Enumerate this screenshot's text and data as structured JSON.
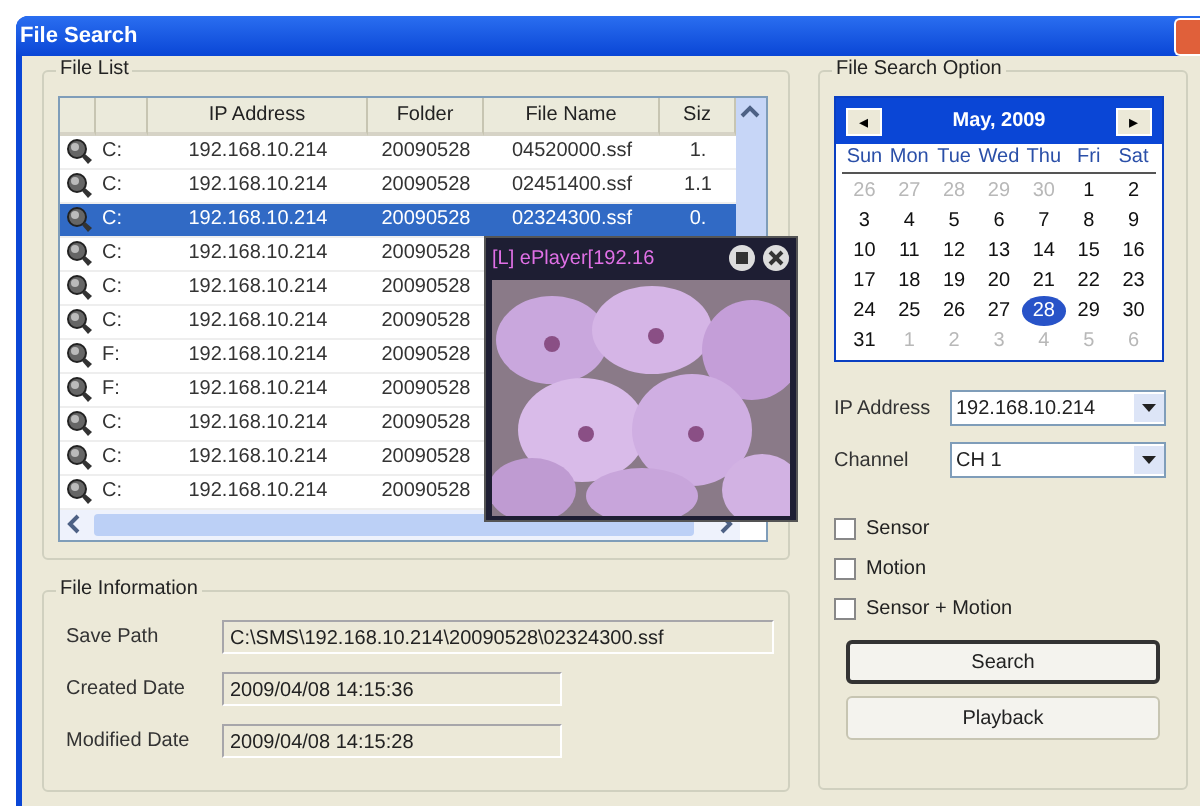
{
  "window": {
    "title": "File Search"
  },
  "file_list": {
    "title": "File List",
    "columns": [
      "IP Address",
      "Folder",
      "File Name",
      "Siz"
    ],
    "rows": [
      {
        "drive": "C:",
        "ip": "192.168.10.214",
        "folder": "20090528",
        "file": "04520000.ssf",
        "size": "1.",
        "selected": false
      },
      {
        "drive": "C:",
        "ip": "192.168.10.214",
        "folder": "20090528",
        "file": "02451400.ssf",
        "size": "1.1",
        "selected": false
      },
      {
        "drive": "C:",
        "ip": "192.168.10.214",
        "folder": "20090528",
        "file": "02324300.ssf",
        "size": "0.",
        "selected": true
      },
      {
        "drive": "C:",
        "ip": "192.168.10.214",
        "folder": "20090528",
        "selected": false
      },
      {
        "drive": "C:",
        "ip": "192.168.10.214",
        "folder": "20090528",
        "selected": false
      },
      {
        "drive": "C:",
        "ip": "192.168.10.214",
        "folder": "20090528",
        "selected": false
      },
      {
        "drive": "F:",
        "ip": "192.168.10.214",
        "folder": "20090528",
        "selected": false
      },
      {
        "drive": "F:",
        "ip": "192.168.10.214",
        "folder": "20090528",
        "selected": false
      },
      {
        "drive": "C:",
        "ip": "192.168.10.214",
        "folder": "20090528",
        "selected": false
      },
      {
        "drive": "C:",
        "ip": "192.168.10.214",
        "folder": "20090528",
        "selected": false
      },
      {
        "drive": "C:",
        "ip": "192.168.10.214",
        "folder": "20090528",
        "selected": false
      }
    ]
  },
  "player": {
    "title": "[L] ePlayer[192.16"
  },
  "file_information": {
    "title": "File Information",
    "fields": [
      {
        "label": "Save Path",
        "value": "C:\\SMS\\192.168.10.214\\20090528\\02324300.ssf",
        "kind": "wide"
      },
      {
        "label": "Created Date",
        "value": "2009/04/08 14:15:36",
        "kind": "short"
      },
      {
        "label": "Modified Date",
        "value": "2009/04/08 14:15:28",
        "kind": "short"
      }
    ]
  },
  "search_option": {
    "title": "File Search Option",
    "calendar": {
      "month": "May, 2009",
      "prev": "◂",
      "next": "▸",
      "weekdays": [
        "Sun",
        "Mon",
        "Tue",
        "Wed",
        "Thu",
        "Fri",
        "Sat"
      ],
      "days": [
        {
          "label": "26",
          "other_month": true,
          "selected": false
        },
        {
          "label": "27",
          "other_month": true,
          "selected": false
        },
        {
          "label": "28",
          "other_month": true,
          "selected": false
        },
        {
          "label": "29",
          "other_month": true,
          "selected": false
        },
        {
          "label": "30",
          "other_month": true,
          "selected": false
        },
        {
          "label": "1",
          "other_month": false,
          "selected": false
        },
        {
          "label": "2",
          "other_month": false,
          "selected": false
        },
        {
          "label": "3",
          "other_month": false,
          "selected": false
        },
        {
          "label": "4",
          "other_month": false,
          "selected": false
        },
        {
          "label": "5",
          "other_month": false,
          "selected": false
        },
        {
          "label": "6",
          "other_month": false,
          "selected": false
        },
        {
          "label": "7",
          "other_month": false,
          "selected": false
        },
        {
          "label": "8",
          "other_month": false,
          "selected": false
        },
        {
          "label": "9",
          "other_month": false,
          "selected": false
        },
        {
          "label": "10",
          "other_month": false,
          "selected": false
        },
        {
          "label": "11",
          "other_month": false,
          "selected": false
        },
        {
          "label": "12",
          "other_month": false,
          "selected": false
        },
        {
          "label": "13",
          "other_month": false,
          "selected": false
        },
        {
          "label": "14",
          "other_month": false,
          "selected": false
        },
        {
          "label": "15",
          "other_month": false,
          "selected": false
        },
        {
          "label": "16",
          "other_month": false,
          "selected": false
        },
        {
          "label": "17",
          "other_month": false,
          "selected": false
        },
        {
          "label": "18",
          "other_month": false,
          "selected": false
        },
        {
          "label": "19",
          "other_month": false,
          "selected": false
        },
        {
          "label": "20",
          "other_month": false,
          "selected": false
        },
        {
          "label": "21",
          "other_month": false,
          "selected": false
        },
        {
          "label": "22",
          "other_month": false,
          "selected": false
        },
        {
          "label": "23",
          "other_month": false,
          "selected": false
        },
        {
          "label": "24",
          "other_month": false,
          "selected": false
        },
        {
          "label": "25",
          "other_month": false,
          "selected": false
        },
        {
          "label": "26",
          "other_month": false,
          "selected": false
        },
        {
          "label": "27",
          "other_month": false,
          "selected": false
        },
        {
          "label": "28",
          "other_month": false,
          "selected": true
        },
        {
          "label": "29",
          "other_month": false,
          "selected": false
        },
        {
          "label": "30",
          "other_month": false,
          "selected": false
        },
        {
          "label": "31",
          "other_month": false,
          "selected": false
        },
        {
          "label": "1",
          "other_month": true,
          "selected": false
        },
        {
          "label": "2",
          "other_month": true,
          "selected": false
        },
        {
          "label": "3",
          "other_month": true,
          "selected": false
        },
        {
          "label": "4",
          "other_month": true,
          "selected": false
        },
        {
          "label": "5",
          "other_month": true,
          "selected": false
        },
        {
          "label": "6",
          "other_month": true,
          "selected": false
        }
      ]
    },
    "dropdowns": [
      {
        "label": "IP Address",
        "value": "192.168.10.214"
      },
      {
        "label": "Channel",
        "value": "CH 1"
      }
    ],
    "checkboxes": [
      {
        "label": "Sensor",
        "checked": false
      },
      {
        "label": "Motion",
        "checked": false
      },
      {
        "label": "Sensor + Motion",
        "checked": false
      }
    ],
    "buttons": [
      {
        "label": "Search",
        "default": true
      },
      {
        "label": "Playback",
        "default": false
      }
    ]
  }
}
